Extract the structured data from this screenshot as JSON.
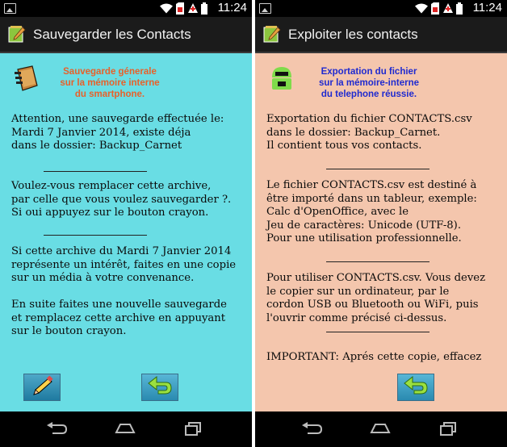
{
  "status": {
    "time": "11:24"
  },
  "left_screen": {
    "title": "Sauvegarder les Contacts",
    "header_text": "Sauvegarde génerale\nsur la mémoire interne\ndu smartphone.",
    "paragraphs": [
      "Attention, une sauvegarde effectuée le:\nMardi 7 Janvier 2014,  existe déja\ndans le dossier: Backup_Carnet",
      "Voulez-vous remplacer cette archive,\npar celle que vous voulez sauvegarder ?.\nSi oui appuyez sur le bouton crayon.",
      "Si cette archive du Mardi 7 Janvier 2014\nreprésente un intérêt, faites en une copie\nsur un média à votre convenance.",
      "En suite faites une nouvelle sauvegarde\net remplacez cette archive en appuyant\nsur le bouton crayon."
    ]
  },
  "right_screen": {
    "title": "Exploiter les contacts",
    "header_text": "Exportation du fichier\nsur la mémoire-interne\ndu telephone réussie.",
    "paragraphs": [
      "Exportation du fichier CONTACTS.csv\ndans le dossier: Backup_Carnet.\nIl contient tous vos contacts.",
      "Le fichier CONTACTS.csv est destiné à\nêtre importé dans un tableur, exemple:\n Calc d'OpenOffice, avec le\n Jeu de caractères: Unicode (UTF-8).\nPour une utilisation professionnelle.",
      "Pour utiliser CONTACTS.csv. Vous devez\nle copier sur un ordinateur, par le\ncordon USB ou Bluetooth ou WiFi, puis\nl'ouvrir comme précisé ci-dessus.",
      "IMPORTANT: Aprés cette copie, effacez"
    ]
  },
  "colors": {
    "left_bg": "#69dde4",
    "right_bg": "#f4c6ad",
    "left_header": "#e8612a",
    "right_header": "#1f2ad0"
  },
  "icons": [
    "image-icon",
    "wifi-icon",
    "sim-icon",
    "warning-icon",
    "battery-icon",
    "notepad-icon",
    "contacts-book-icon",
    "android-robot-icon",
    "pencil-icon",
    "back-arrow-icon",
    "nav-back-icon",
    "nav-home-icon",
    "nav-recents-icon"
  ]
}
